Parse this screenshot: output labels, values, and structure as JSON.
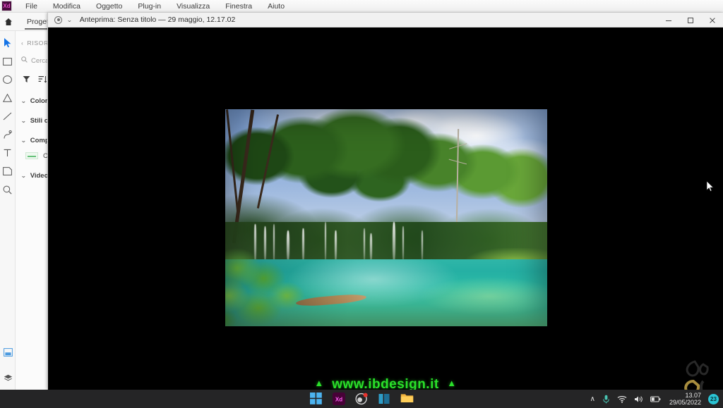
{
  "app": {
    "name": "Adobe XD",
    "logo_text": "Xd",
    "menu": [
      {
        "label": "File"
      },
      {
        "label": "Modifica"
      },
      {
        "label": "Oggetto"
      },
      {
        "label": "Plug-in"
      },
      {
        "label": "Visualizza"
      },
      {
        "label": "Finestra"
      },
      {
        "label": "Aiuto"
      }
    ],
    "tab": {
      "label": "Progetta"
    },
    "toolbar": [
      {
        "icon": "home-icon",
        "name": "home"
      },
      {
        "icon": "select-arrow-icon",
        "name": "select",
        "active": true
      },
      {
        "icon": "rectangle-icon",
        "name": "rectangle"
      },
      {
        "icon": "ellipse-icon",
        "name": "ellipse"
      },
      {
        "icon": "polygon-icon",
        "name": "polygon"
      },
      {
        "icon": "line-icon",
        "name": "line"
      },
      {
        "icon": "pen-icon",
        "name": "pen"
      },
      {
        "icon": "text-icon",
        "name": "text"
      },
      {
        "icon": "artboard-icon",
        "name": "artboard"
      },
      {
        "icon": "zoom-icon",
        "name": "zoom"
      }
    ],
    "toolbar_bottom": [
      {
        "icon": "assets-library-icon",
        "name": "assets-library"
      },
      {
        "icon": "layers-icon",
        "name": "layers"
      }
    ],
    "assets_panel": {
      "back_label": "RISORSE",
      "search_placeholder": "Cerca",
      "filter_icon": "filter-icon",
      "sort_icon": "sort-icon",
      "sections": [
        {
          "label": "Colori"
        },
        {
          "label": "Stili car"
        },
        {
          "label": "Compo"
        },
        {
          "label": "Video"
        }
      ],
      "component_item": {
        "label": "Com"
      }
    }
  },
  "preview_window": {
    "title": "Anteprima: Senza titolo — 29 maggio, 12.17.02",
    "record_icon": "record-preview-icon",
    "chevron_icon": "chevron-down-icon",
    "controls": {
      "minimize": "—",
      "maximize": "☐",
      "close": "✕"
    },
    "artboard": {
      "alt": "Foto natura: cascate, lago turchese e bosco rigoglioso"
    }
  },
  "watermark": {
    "text": "www.ibdesign.it",
    "triangle": "▲",
    "color": "#2ae02a",
    "logo_name": "ibdesign-leaf-logo"
  },
  "taskbar": {
    "items": [
      {
        "name": "start-button",
        "label": "Start"
      },
      {
        "name": "adobe-xd-taskbar-icon",
        "label": "Xd"
      },
      {
        "name": "obs-studio-taskbar-icon",
        "label": "OBS"
      },
      {
        "name": "app-taskbar-icon",
        "label": "App"
      },
      {
        "name": "file-explorer-taskbar-icon",
        "label": "Esplora file"
      }
    ],
    "tray": {
      "chevron": "∧",
      "microphone_icon": "microphone-icon",
      "wifi_icon": "wifi-icon",
      "volume_icon": "volume-icon",
      "battery_icon": "battery-icon",
      "time": "13.07",
      "date": "29/05/2022",
      "notification_count": "23"
    }
  },
  "colors": {
    "accent_xd": "#e84ecb",
    "taskbar_bg": "#252526",
    "watermark_green": "#2ae02a",
    "lake_turquoise": "#2cbba6"
  }
}
